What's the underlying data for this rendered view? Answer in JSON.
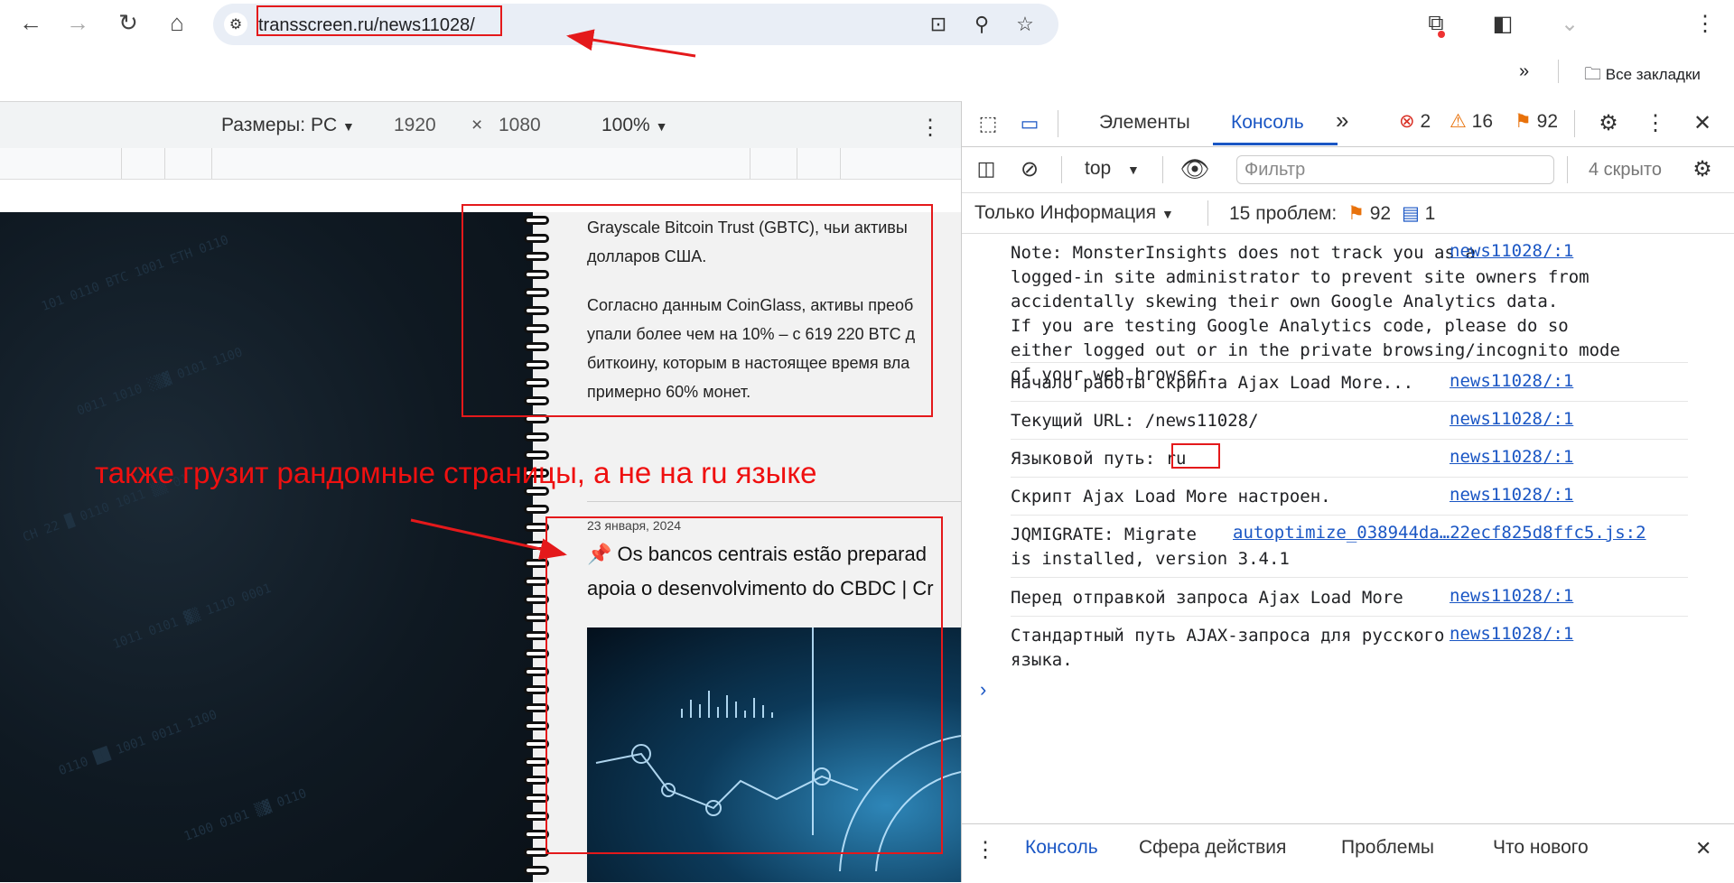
{
  "browser": {
    "url": "transscreen.ru/news11028/",
    "bookmarks_all": "Все закладки"
  },
  "device_toolbar": {
    "size_label": "Размеры: PC",
    "width": "1920",
    "times": "×",
    "height": "1080",
    "zoom": "100%"
  },
  "page": {
    "para1_line1": "Grayscale Bitcoin Trust (GBTC), чьи активы",
    "para1_line2": "долларов США.",
    "para2_line1": "Согласно данным CoinGlass, активы преоб",
    "para2_line2": "упали более чем на 10% – с 619 220 BTC д",
    "para2_line3": "биткоину, которым в настоящее время вла",
    "para2_line4": "примерно 60% монет.",
    "date": "23 января, 2024",
    "title_line1": "Os bancos centrais estão preparad",
    "title_line2": "apoia o desenvolvimento do CBDC | Cr"
  },
  "annotation": {
    "text": "также грузит рандомные страницы, а не на ru языке"
  },
  "devtools": {
    "tabs": [
      "Элементы",
      "Консоль"
    ],
    "errors": "2",
    "warnings": "16",
    "issues": "92",
    "context": "top",
    "filter_placeholder": "Фильтр",
    "hidden": "4 скрыто",
    "levels": "Только Информация",
    "problems": "15 проблем:",
    "problems_issues": "92",
    "problems_info": "1",
    "messages": [
      {
        "text": "Note: MonsterInsights does not track you as a\nlogged-in site administrator to prevent site owners from\naccidentally skewing their own Google Analytics data.\nIf you are testing Google Analytics code, please do so\neither logged out or in the private browsing/incognito mode\nof your web browser.",
        "src": "news11028/:1"
      },
      {
        "text": "Начало работы скрипта Ajax Load More...",
        "src": "news11028/:1"
      },
      {
        "text": "Текущий URL: /news11028/",
        "src": "news11028/:1"
      },
      {
        "text": "Языковой путь: ru",
        "src": "news11028/:1"
      },
      {
        "text": "Скрипт Ajax Load More настроен.",
        "src": "news11028/:1"
      },
      {
        "text": "JQMIGRATE: Migrate\nis installed, version 3.4.1",
        "src": "autoptimize_038944da…22ecf825d8ffc5.js:2"
      },
      {
        "text": "Перед отправкой запроса Ajax Load More",
        "src": "news11028/:1"
      },
      {
        "text": "Стандартный путь AJAX-запроса для русского\nязыка.",
        "src": "news11028/:1"
      }
    ],
    "drawer_tabs": [
      "Консоль",
      "Сфера действия",
      "Проблемы",
      "Что нового"
    ]
  }
}
